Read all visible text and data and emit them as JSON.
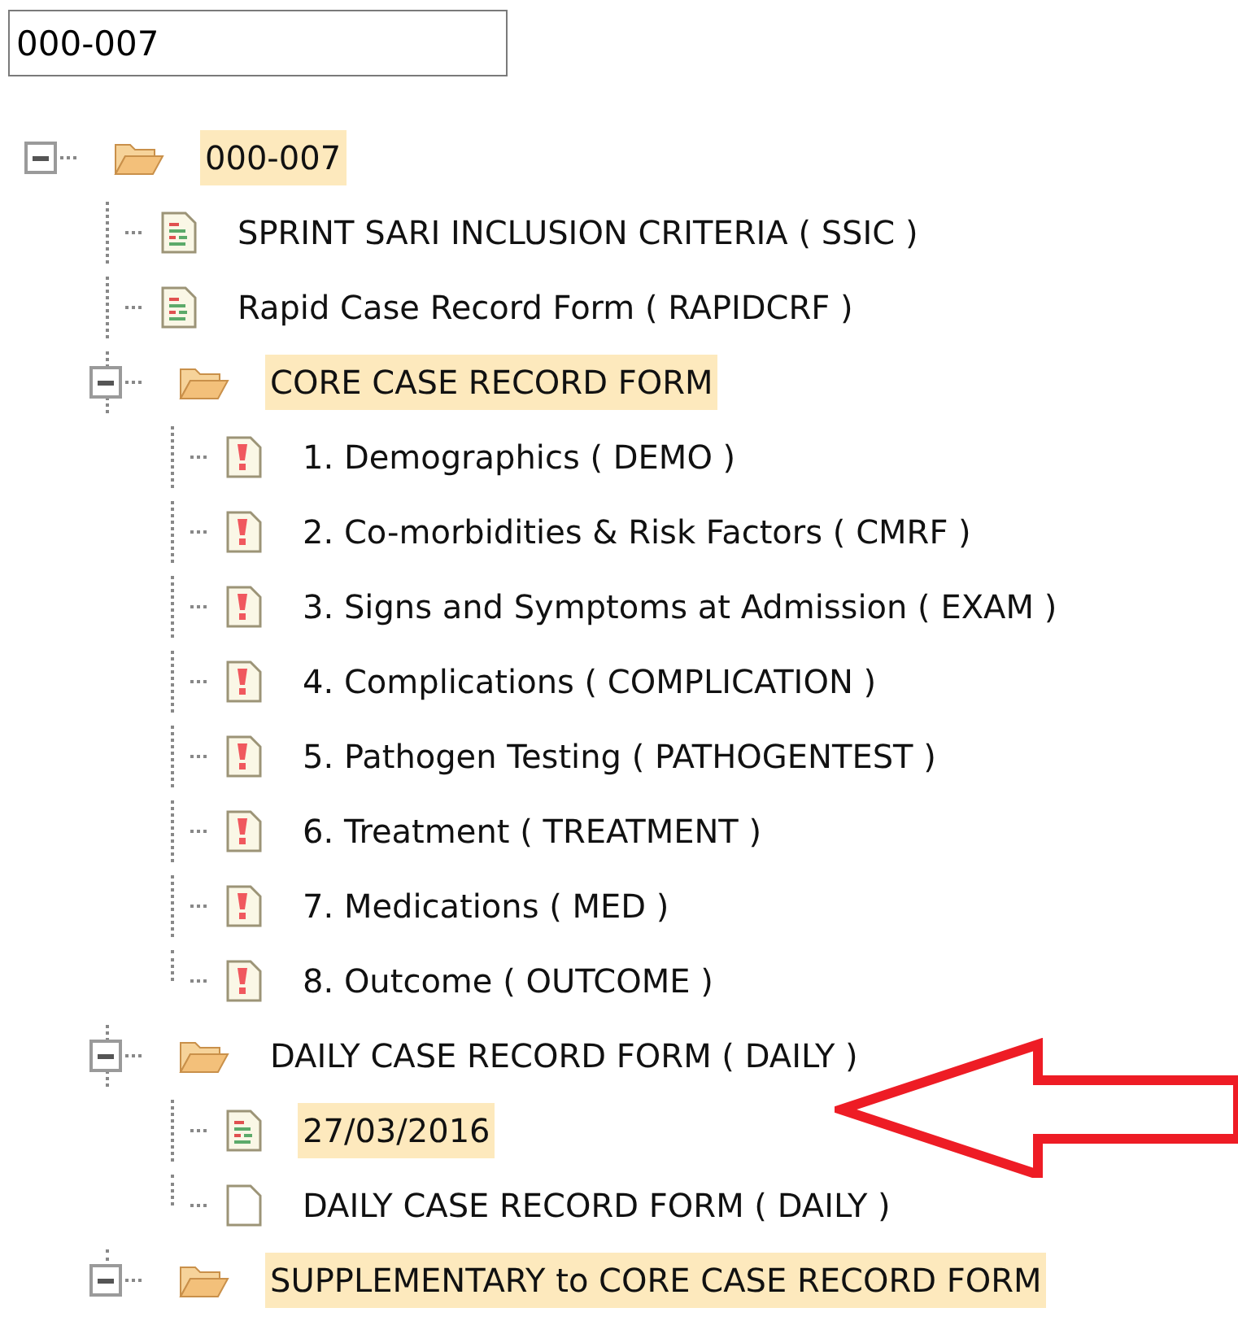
{
  "search": {
    "value": "000-007"
  },
  "tree": [
    {
      "label": "000-007",
      "kind": "folder",
      "expanded": true,
      "highlighted": true,
      "children": [
        {
          "label": "SPRINT SARI INCLUSION CRITERIA ( SSIC )",
          "kind": "form",
          "highlighted": false
        },
        {
          "label": "Rapid Case Record Form ( RAPIDCRF )",
          "kind": "form",
          "highlighted": false
        },
        {
          "label": "CORE CASE RECORD FORM",
          "kind": "folder",
          "expanded": true,
          "highlighted": true,
          "children": [
            {
              "label": "1. Demographics ( DEMO )",
              "kind": "alert",
              "highlighted": false
            },
            {
              "label": "2. Co-morbidities & Risk Factors ( CMRF )",
              "kind": "alert",
              "highlighted": false
            },
            {
              "label": "3. Signs and Symptoms at Admission ( EXAM )",
              "kind": "alert",
              "highlighted": false
            },
            {
              "label": "4. Complications ( COMPLICATION )",
              "kind": "alert",
              "highlighted": false
            },
            {
              "label": "5. Pathogen Testing ( PATHOGENTEST )",
              "kind": "alert",
              "highlighted": false
            },
            {
              "label": "6. Treatment ( TREATMENT )",
              "kind": "alert",
              "highlighted": false
            },
            {
              "label": "7. Medications ( MED )",
              "kind": "alert",
              "highlighted": false
            },
            {
              "label": "8. Outcome ( OUTCOME )",
              "kind": "alert",
              "highlighted": false
            }
          ]
        },
        {
          "label": "DAILY CASE RECORD FORM ( DAILY )",
          "kind": "folder",
          "expanded": true,
          "highlighted": false,
          "children": [
            {
              "label": "27/03/2016",
              "kind": "form",
              "highlighted": true
            },
            {
              "label": "DAILY CASE RECORD FORM ( DAILY )",
              "kind": "blank",
              "highlighted": false
            }
          ]
        },
        {
          "label": "SUPPLEMENTARY to CORE CASE RECORD FORM",
          "kind": "folder",
          "expanded": true,
          "highlighted": true
        }
      ]
    }
  ]
}
